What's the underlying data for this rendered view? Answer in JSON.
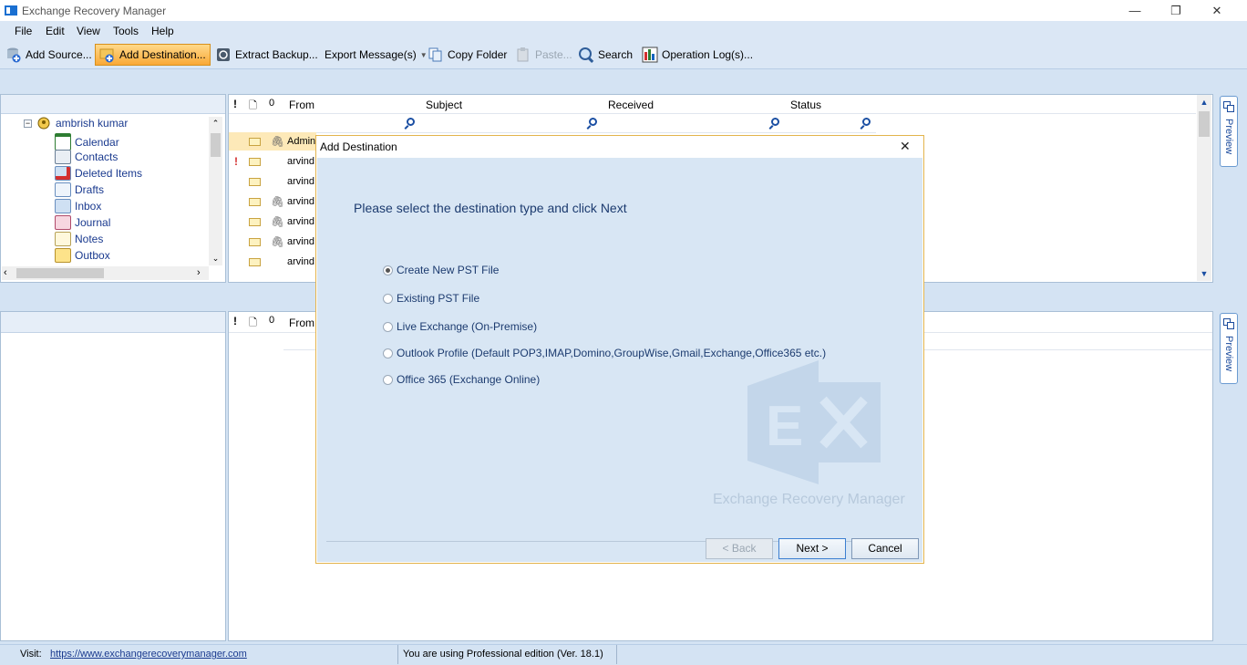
{
  "window": {
    "title": "Exchange Recovery Manager",
    "minimize": "—",
    "maximize": "❐",
    "close": "✕"
  },
  "menu": [
    "File",
    "Edit",
    "View",
    "Tools",
    "Help"
  ],
  "toolbar": {
    "add_source": "Add Source...",
    "add_destination": "Add Destination...",
    "extract_backup": "Extract Backup...",
    "export_messages": "Export Message(s)",
    "copy_folder": "Copy Folder",
    "paste": "Paste...",
    "search": "Search",
    "operation_logs": "Operation Log(s)..."
  },
  "tree": {
    "root": "ambrish kumar",
    "items": [
      "Calendar",
      "Contacts",
      "Deleted Items",
      "Drafts",
      "Inbox",
      "Journal",
      "Notes",
      "Outbox"
    ]
  },
  "grid": {
    "headers": {
      "importance": "!",
      "type": "🗋",
      "attachment": "0",
      "from": "From",
      "subject": "Subject",
      "received": "Received",
      "status": "Status"
    },
    "rows": [
      "Admini",
      "arvind",
      "arvind",
      "arvind",
      "arvind",
      "arvind",
      "arvind"
    ]
  },
  "lower_grid": {
    "headers": {
      "importance": "!",
      "type": "🗋",
      "attachment": "0",
      "from": "From"
    }
  },
  "preview_label": "Preview",
  "dialog": {
    "title": "Add Destination",
    "close": "✕",
    "heading": "Please select the destination type and click Next",
    "options": [
      "Create New PST File",
      "Existing PST File",
      "Live Exchange (On-Premise)",
      "Outlook Profile (Default POP3,IMAP,Domino,GroupWise,Gmail,Exchange,Office365 etc.)",
      "Office 365 (Exchange Online)"
    ],
    "selected_index": 0,
    "watermark": "Exchange Recovery Manager",
    "back": "< Back",
    "next": "Next >",
    "cancel": "Cancel"
  },
  "status": {
    "visit_label": "Visit:",
    "url": "https://www.exchangerecoverymanager.com",
    "edition": "You are using Professional edition (Ver. 18.1)"
  }
}
